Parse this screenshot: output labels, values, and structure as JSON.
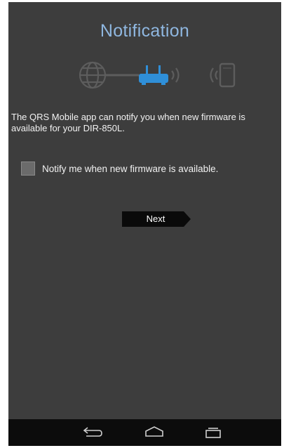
{
  "screen": {
    "title": "Notification",
    "description": "The QRS Mobile app can notify you when new firmware is available for your DIR-850L.",
    "notify_option": {
      "label": "Notify me when new firmware is available.",
      "checked": false
    },
    "next_label": "Next"
  },
  "diagram": {
    "icons": [
      "globe-icon",
      "router-icon",
      "wifi-signal-icon",
      "phone-icon"
    ],
    "colors": {
      "muted": "#5a5a5a",
      "router": "#2f8fd8"
    }
  },
  "navbar": {
    "icons": [
      "back-icon",
      "home-icon",
      "recent-apps-icon"
    ]
  },
  "colors": {
    "background": "#3d3d3d",
    "title": "#8fb7e0",
    "navbar": "#0c0c0c",
    "button": "#0a0a0a"
  }
}
